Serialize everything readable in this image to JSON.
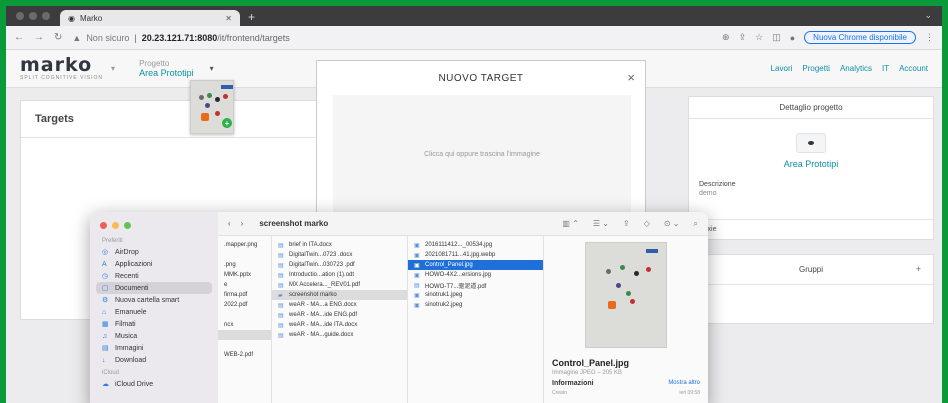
{
  "browser": {
    "tab_title": "Marko",
    "url_warning": "Non sicuro",
    "url_host": "20.23.121.71:8080",
    "url_path": "/it/frontend/targets",
    "update_pill": "Nuova Chrome disponibile"
  },
  "app": {
    "logo": "marko",
    "logo_sub": "SPLIT COGNITIVE VISION",
    "project_label": "Progetto",
    "project_value": "Area Prototipi",
    "menu": [
      "Lavori",
      "Progetti",
      "Analytics",
      "IT",
      "Account"
    ]
  },
  "targets": {
    "title": "Targets",
    "button": "T"
  },
  "detail": {
    "title": "Dettaglio progetto",
    "name": "Area Prototipi",
    "desc_label": "Descrizione",
    "desc_value": "demo",
    "footer": "Boxie"
  },
  "groups": {
    "title": "Gruppi",
    "add": "+"
  },
  "modal": {
    "title": "NUOVO TARGET",
    "close": "×",
    "dropzone_text": "Clicca qui oppure trascina l'immagine"
  },
  "finder": {
    "title": "screenshot marko",
    "sidebar_sections": [
      "Preferiti",
      "iCloud"
    ],
    "sidebar_items": [
      {
        "label": "AirDrop",
        "icon": "◎"
      },
      {
        "label": "Applicazioni",
        "icon": "A"
      },
      {
        "label": "Recenti",
        "icon": "◷"
      },
      {
        "label": "Documenti",
        "icon": "▢"
      },
      {
        "label": "Nuova cartella smart",
        "icon": "⚙"
      },
      {
        "label": "Emanuele",
        "icon": "⌂"
      },
      {
        "label": "Filmati",
        "icon": "▦"
      },
      {
        "label": "Musica",
        "icon": "♫"
      },
      {
        "label": "Immagini",
        "icon": "▤"
      },
      {
        "label": "Download",
        "icon": "↓"
      }
    ],
    "icloud_item": "iCloud Drive",
    "col1": [
      ".mapper.png",
      "",
      ".png",
      "MMK.pptx",
      "e",
      "firma.pdf",
      "2022.pdf",
      "",
      "ncx",
      "",
      "",
      "WEB-2.pdf"
    ],
    "col2": [
      "brief in ITA.docx",
      "DigitalTwin...0723 .docx",
      "DigitalTwin...030723 .pdf",
      "Introductio...ation (1).odt",
      "MX Accelera..._REV01.pdf",
      "screenshot marko",
      "weAR - MA...a ENG.docx",
      "weAR - MA...ide ENG.pdf",
      "weAR - MA...ide ITA.docx",
      "weAR - MA...guide.docx"
    ],
    "col3": [
      "2016111412..._00534.jpg",
      "2021081711...41.jpg.webp",
      "Control_Panel.jpg",
      "HOWO-4X2...ersions.jpg",
      "HOWO-T7...驱泥道.pdf",
      "sinotruk1.jpeg",
      "sinotruk2.jpeg"
    ],
    "preview_name": "Control_Panel.jpg",
    "preview_meta": "Immagine JPEG – 205 KB",
    "info_label": "Informazioni",
    "info_more": "Mostra altro",
    "preview_row_left": "Creato",
    "preview_row_right": "ieri 09:58"
  }
}
